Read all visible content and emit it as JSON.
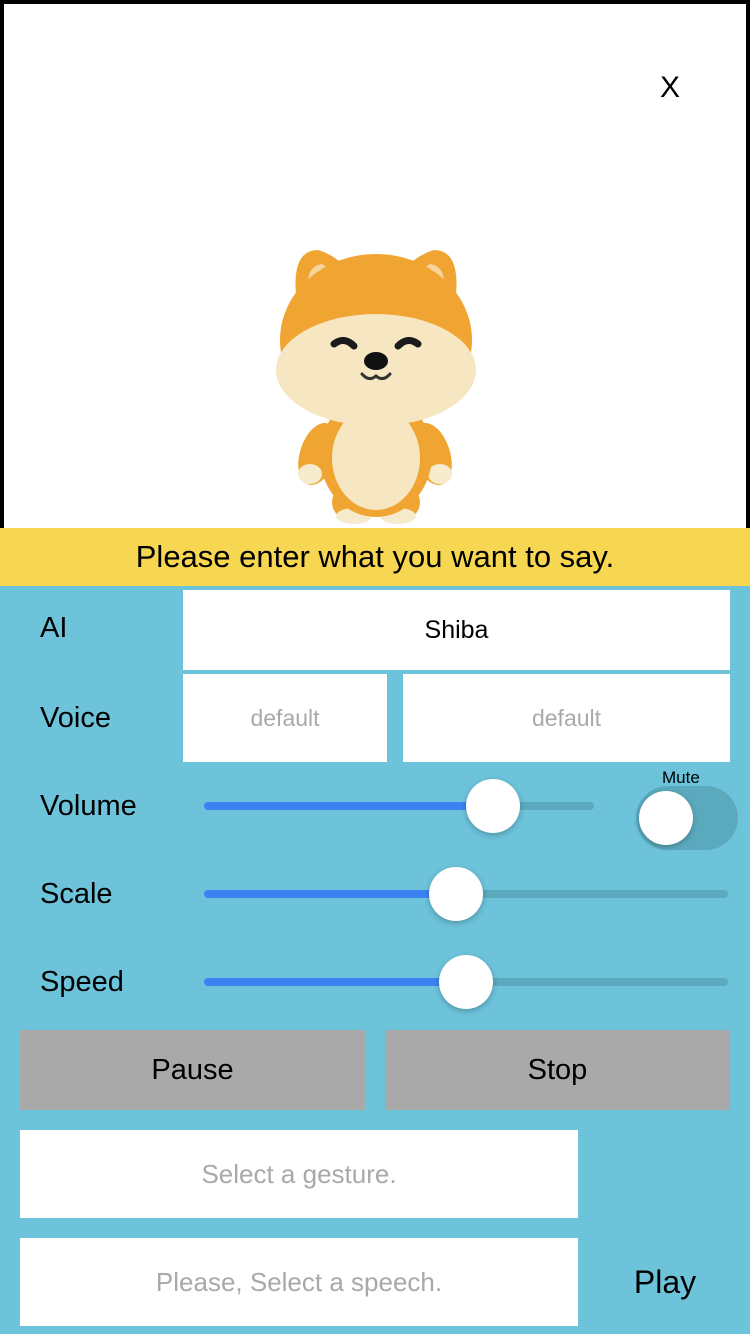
{
  "preview": {
    "close_label": "X"
  },
  "banner": {
    "text": "Please enter what you want to say."
  },
  "ai": {
    "label": "AI",
    "value": "Shiba"
  },
  "voice": {
    "label": "Voice",
    "option1": "default",
    "option2": "default"
  },
  "volume": {
    "label": "Volume",
    "level": 0.74,
    "mute_label": "Mute",
    "mute_on": false
  },
  "scale": {
    "label": "Scale",
    "level": 0.48
  },
  "speed": {
    "label": "Speed",
    "level": 0.5
  },
  "buttons": {
    "pause": "Pause",
    "stop": "Stop",
    "play": "Play"
  },
  "gesture": {
    "placeholder": "Select a gesture."
  },
  "speech": {
    "placeholder": "Please, Select a speech."
  },
  "colors": {
    "panel": "#6cc3da",
    "banner": "#f7d752",
    "slider_fill": "#3d82f4",
    "button_gray": "#a9a9a9"
  }
}
